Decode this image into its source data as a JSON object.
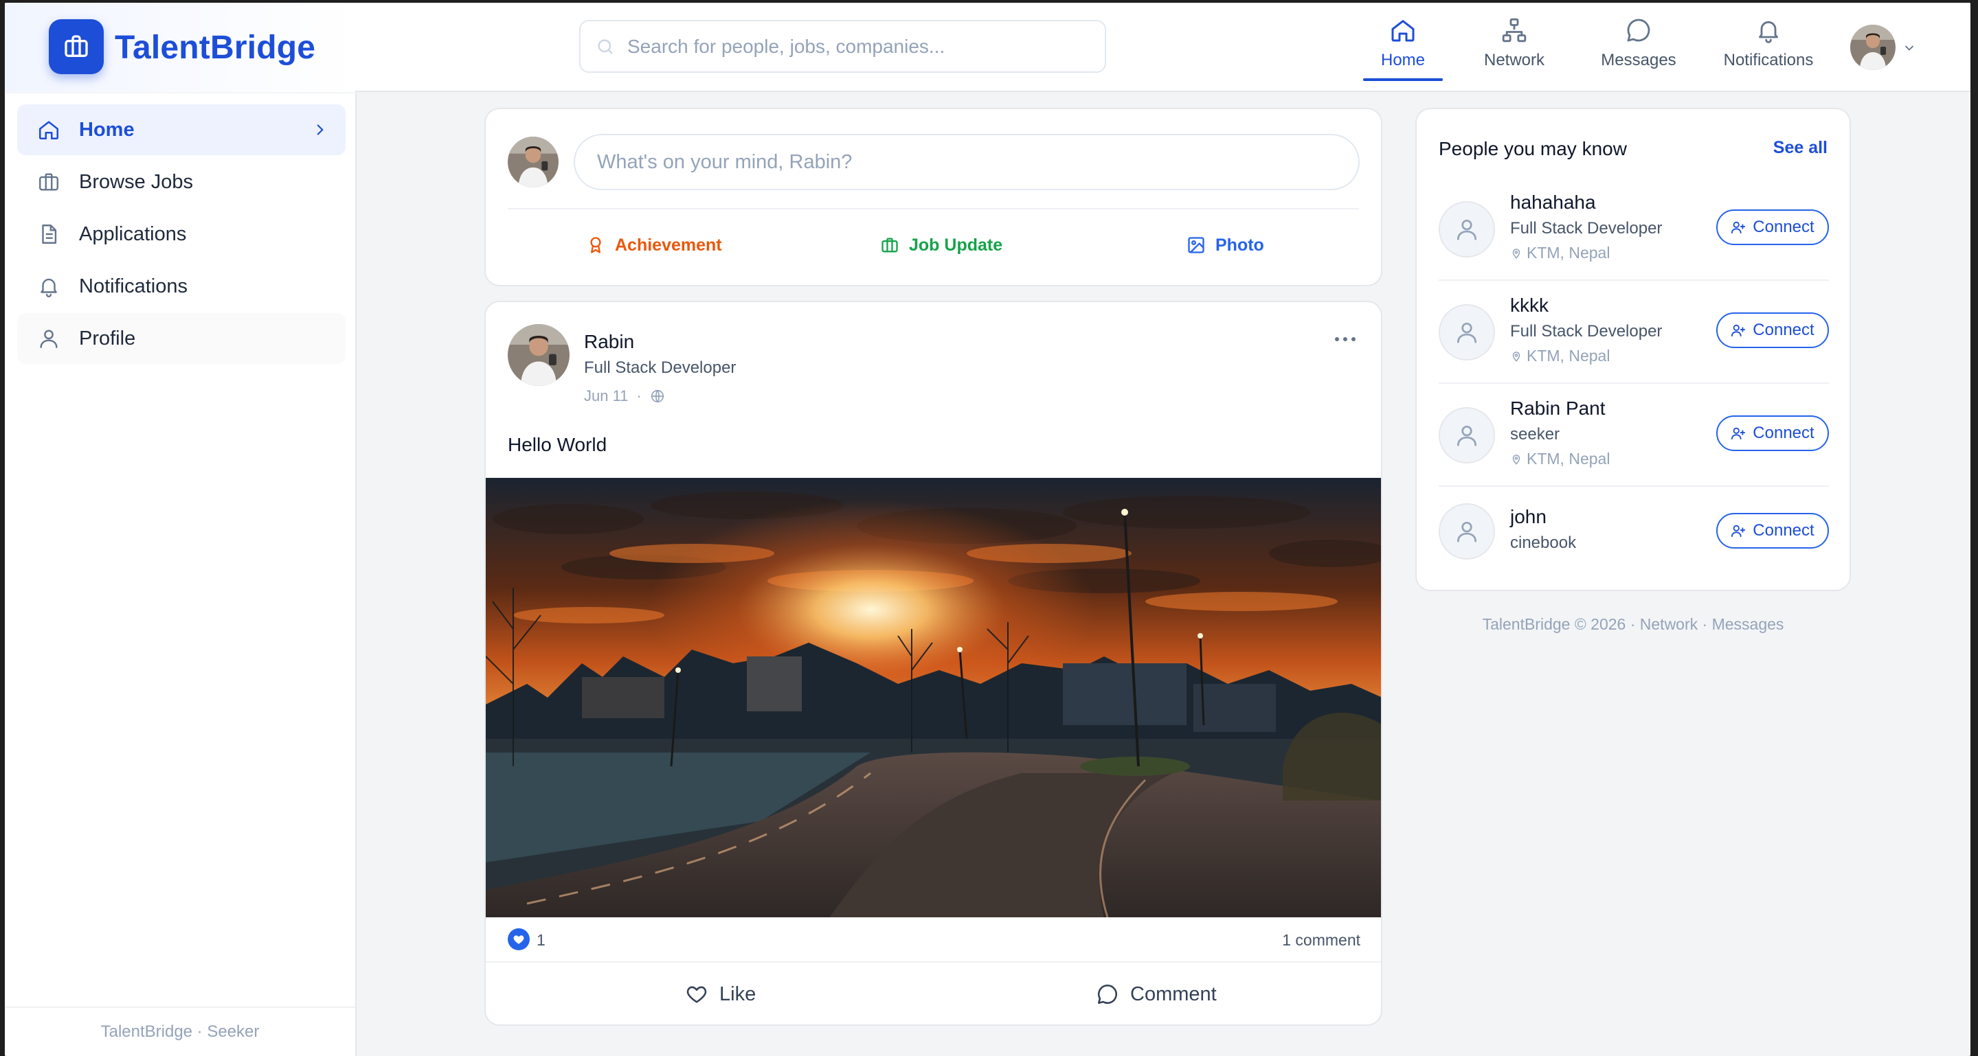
{
  "brand": {
    "name": "TalentBridge",
    "accent": "#1d4ed8"
  },
  "search": {
    "placeholder": "Search for people, jobs, companies..."
  },
  "nav": {
    "items": [
      {
        "label": "Home",
        "icon": "home-icon",
        "active": true
      },
      {
        "label": "Network",
        "icon": "network-icon",
        "active": false
      },
      {
        "label": "Messages",
        "icon": "message-icon",
        "active": false
      },
      {
        "label": "Notifications",
        "icon": "bell-icon",
        "active": false
      }
    ]
  },
  "sidebar": {
    "items": [
      {
        "label": "Home",
        "icon": "home-icon",
        "active": true
      },
      {
        "label": "Browse Jobs",
        "icon": "briefcase-icon",
        "active": false
      },
      {
        "label": "Applications",
        "icon": "document-icon",
        "active": false
      },
      {
        "label": "Notifications",
        "icon": "bell-icon",
        "active": false
      },
      {
        "label": "Profile",
        "icon": "user-icon",
        "active": false
      }
    ],
    "footer": "TalentBridge · Seeker"
  },
  "composer": {
    "placeholder": "What's on your mind, Rabin?",
    "actions": [
      {
        "label": "Achievement",
        "icon": "award-icon",
        "color": "#ea580c"
      },
      {
        "label": "Job Update",
        "icon": "briefcase-icon",
        "color": "#16a34a"
      },
      {
        "label": "Photo",
        "icon": "image-icon",
        "color": "#2563eb"
      }
    ]
  },
  "post": {
    "author": "Rabin",
    "role": "Full Stack Developer",
    "date": "Jun 11",
    "visibility_icon": "globe-icon",
    "text": "Hello World",
    "image_icon": "sunset-road-photo",
    "likes": "1",
    "comments": "1 comment",
    "like_label": "Like",
    "comment_label": "Comment"
  },
  "pymk": {
    "title": "People you may know",
    "see_all": "See all",
    "connect_label": "Connect",
    "people": [
      {
        "name": "hahahaha",
        "role": "Full Stack Developer",
        "location": "KTM, Nepal"
      },
      {
        "name": "kkkk",
        "role": "Full Stack Developer",
        "location": "KTM, Nepal"
      },
      {
        "name": "Rabin Pant",
        "role": "seeker",
        "location": "KTM, Nepal"
      },
      {
        "name": "john",
        "role": "cinebook",
        "location": ""
      }
    ]
  },
  "footer": {
    "copyright": "TalentBridge © 2026 · ",
    "link1": "Network",
    "sep": " · ",
    "link2": "Messages"
  }
}
